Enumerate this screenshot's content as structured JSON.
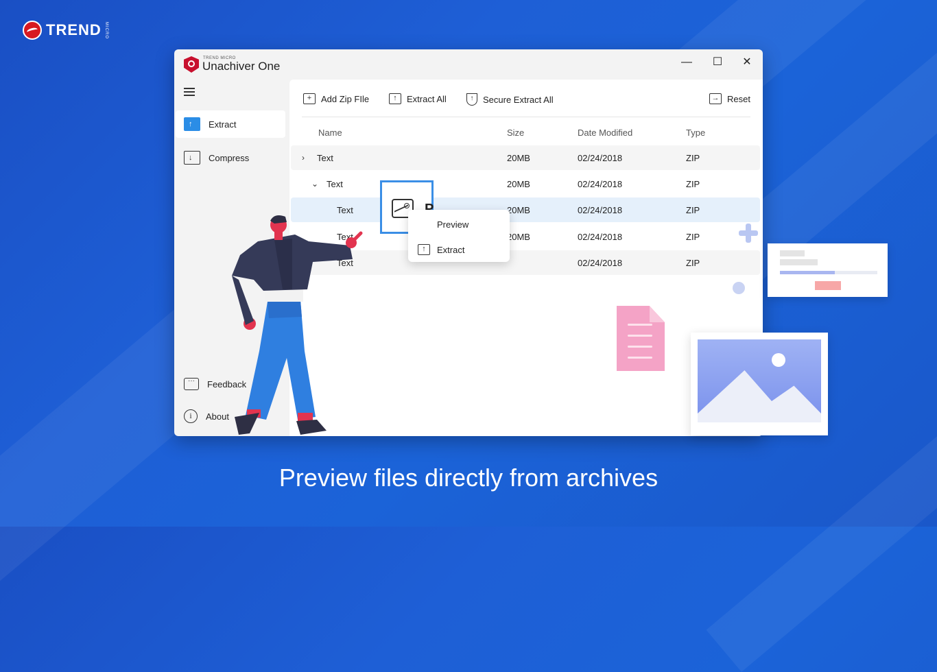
{
  "brand": {
    "name": "TREND",
    "micro": "MICRO"
  },
  "window": {
    "subtitle": "TREND MICRO",
    "title": "Unachiver One",
    "controls": {
      "minimize": "—",
      "maximize": "☐",
      "close": "✕"
    }
  },
  "sidebar": {
    "items": [
      {
        "label": "Extract"
      },
      {
        "label": "Compress"
      },
      {
        "label": "Feedback"
      },
      {
        "label": "About"
      }
    ]
  },
  "toolbar": {
    "add_zip": "Add Zip FIle",
    "extract_all": "Extract All",
    "secure_extract_all": "Secure Extract All",
    "reset": "Reset"
  },
  "table": {
    "columns": [
      "Name",
      "Size",
      "Date Modified",
      "Type"
    ],
    "rows": [
      {
        "name": "Text",
        "size": "20MB",
        "date": "02/24/2018",
        "type": "ZIP"
      },
      {
        "name": "Text",
        "size": "20MB",
        "date": "02/24/2018",
        "type": "ZIP"
      },
      {
        "name": "Text",
        "size": "20MB",
        "date": "02/24/2018",
        "type": "ZIP"
      },
      {
        "name": "Text",
        "size": "20MB",
        "date": "02/24/2018",
        "type": "ZIP"
      },
      {
        "name": "Text",
        "size": "",
        "date": "02/24/2018",
        "type": "ZIP"
      }
    ]
  },
  "context_menu": {
    "items": [
      {
        "label": "Preview"
      },
      {
        "label": "Extract"
      }
    ],
    "preview_letter": "P"
  },
  "progress_card": {
    "progress": 0.56
  },
  "caption": "Preview files directly from archives",
  "colors": {
    "background": "#1e5fd6",
    "accent": "#2b8de6",
    "brand_red": "#d71920",
    "selected_row": "#e5f0fb"
  }
}
